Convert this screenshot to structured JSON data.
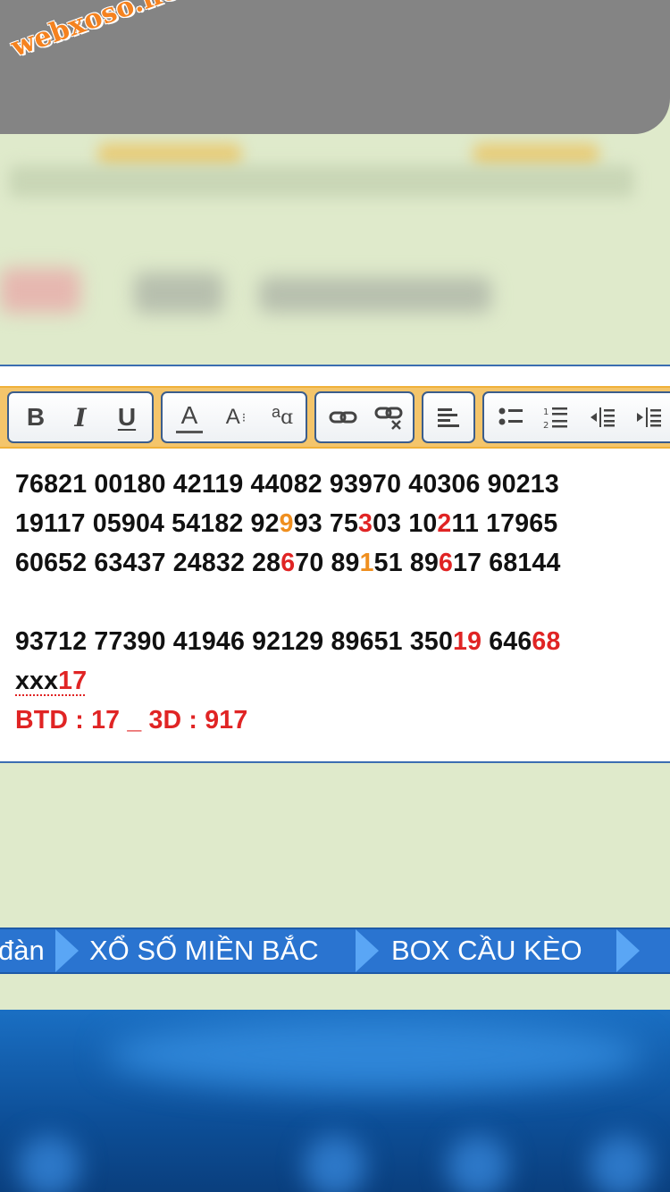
{
  "watermark": {
    "text": "webxoso.net"
  },
  "toolbar": {
    "groups": [
      {
        "name": "format",
        "buttons": [
          {
            "label": "B",
            "icon": "bold-icon"
          },
          {
            "label": "I",
            "icon": "italic-icon"
          },
          {
            "label": "U",
            "icon": "underline-icon"
          }
        ]
      },
      {
        "name": "font",
        "buttons": [
          {
            "label": "A",
            "icon": "font-color-icon"
          },
          {
            "label": "A",
            "icon": "font-size-icon"
          },
          {
            "label": "a",
            "icon": "font-family-icon"
          }
        ]
      },
      {
        "name": "link",
        "buttons": [
          {
            "icon": "link-icon"
          },
          {
            "icon": "unlink-icon"
          }
        ]
      },
      {
        "name": "align",
        "buttons": [
          {
            "icon": "align-left-icon"
          }
        ]
      },
      {
        "name": "list",
        "buttons": [
          {
            "icon": "bulleted-list-icon"
          },
          {
            "icon": "numbered-list-icon"
          },
          {
            "icon": "outdent-icon"
          },
          {
            "icon": "indent-icon"
          }
        ]
      }
    ]
  },
  "content": {
    "line1": "76821 00180 42119 44082 93970 40306 90213",
    "line2": {
      "a": "19117 05904 54182 92",
      "b": "9",
      "c": "93 75",
      "d": "3",
      "e": "03 10",
      "f": "2",
      "g": "11 17965"
    },
    "line3": {
      "a": "60652 63437 24832 28",
      "b": "6",
      "c": "70 89",
      "d": "1",
      "e": "51 89",
      "f": "6",
      "g": "17 68144"
    },
    "line4": {
      "a": "93712 77390 41946 92129 89651 350",
      "b": "19",
      "c": " 646",
      "d": "68"
    },
    "line5": {
      "a": "xxx",
      "b": "17"
    },
    "line6": "BTD : 17 _ 3D : 917"
  },
  "nav": {
    "items": [
      "đàn",
      "XỔ SỐ MIỀN BẮC",
      "BOX CẦU KÈO"
    ]
  },
  "colors": {
    "toolbar_bg": "#f4c56b",
    "nav_bg": "#2a74d0",
    "highlight_red": "#e02424",
    "highlight_orange": "#ef8f1f",
    "page_bg": "#dfeacb"
  }
}
